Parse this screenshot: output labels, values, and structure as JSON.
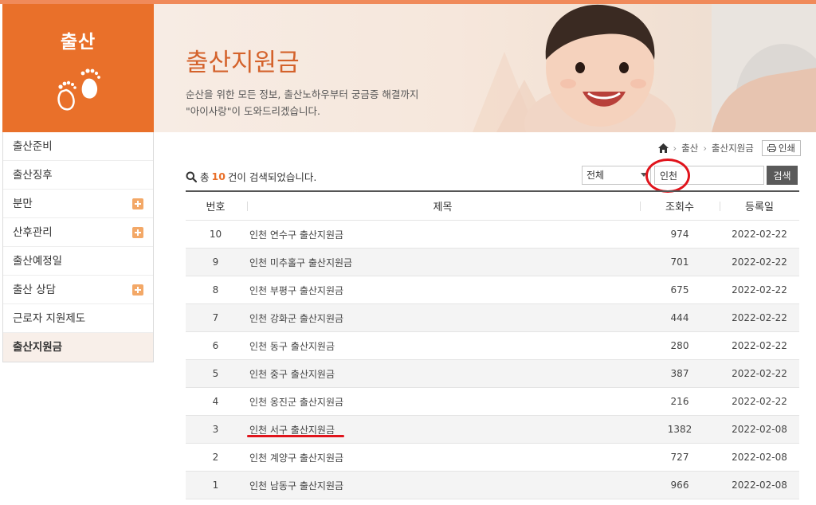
{
  "category": {
    "title": "출산"
  },
  "banner": {
    "title": "출산지원금",
    "desc_line1": "순산을 위한 모든 정보, 출산노하우부터 궁금증 해결까지",
    "desc_line2": "\"아이사랑\"이 도와드리겠습니다."
  },
  "sidebar": {
    "items": [
      {
        "label": "출산준비",
        "expandable": false,
        "active": false
      },
      {
        "label": "출산징후",
        "expandable": false,
        "active": false
      },
      {
        "label": "분만",
        "expandable": true,
        "active": false
      },
      {
        "label": "산후관리",
        "expandable": true,
        "active": false
      },
      {
        "label": "출산예정일",
        "expandable": false,
        "active": false
      },
      {
        "label": "출산 상담",
        "expandable": true,
        "active": false
      },
      {
        "label": "근로자 지원제도",
        "expandable": false,
        "active": false
      },
      {
        "label": "출산지원금",
        "expandable": false,
        "active": true
      }
    ]
  },
  "breadcrumb": {
    "level1": "출산",
    "level2": "출산지원금",
    "print_label": "인쇄"
  },
  "search": {
    "count_prefix": "총",
    "count": "10",
    "count_suffix": "건이 검색되었습니다.",
    "select_value": "전체",
    "query": "인천",
    "button_label": "검색"
  },
  "table": {
    "headers": {
      "num": "번호",
      "title": "제목",
      "views": "조회수",
      "date": "등록일"
    },
    "rows": [
      {
        "num": "10",
        "title": "인천 연수구 출산지원금",
        "views": "974",
        "date": "2022-02-22"
      },
      {
        "num": "9",
        "title": "인천 미추홀구 출산지원금",
        "views": "701",
        "date": "2022-02-22"
      },
      {
        "num": "8",
        "title": "인천 부평구 출산지원금",
        "views": "675",
        "date": "2022-02-22"
      },
      {
        "num": "7",
        "title": "인천 강화군 출산지원금",
        "views": "444",
        "date": "2022-02-22"
      },
      {
        "num": "6",
        "title": "인천 동구 출산지원금",
        "views": "280",
        "date": "2022-02-22"
      },
      {
        "num": "5",
        "title": "인천 중구 출산지원금",
        "views": "387",
        "date": "2022-02-22"
      },
      {
        "num": "4",
        "title": "인천 옹진군 출산지원금",
        "views": "216",
        "date": "2022-02-22"
      },
      {
        "num": "3",
        "title": "인천 서구 출산지원금",
        "views": "1382",
        "date": "2022-02-08"
      },
      {
        "num": "2",
        "title": "인천 계양구 출산지원금",
        "views": "727",
        "date": "2022-02-08"
      },
      {
        "num": "1",
        "title": "인천 남동구 출산지원금",
        "views": "966",
        "date": "2022-02-08"
      }
    ]
  },
  "colors": {
    "accent": "#e9702a",
    "highlight": "#e0141c"
  }
}
